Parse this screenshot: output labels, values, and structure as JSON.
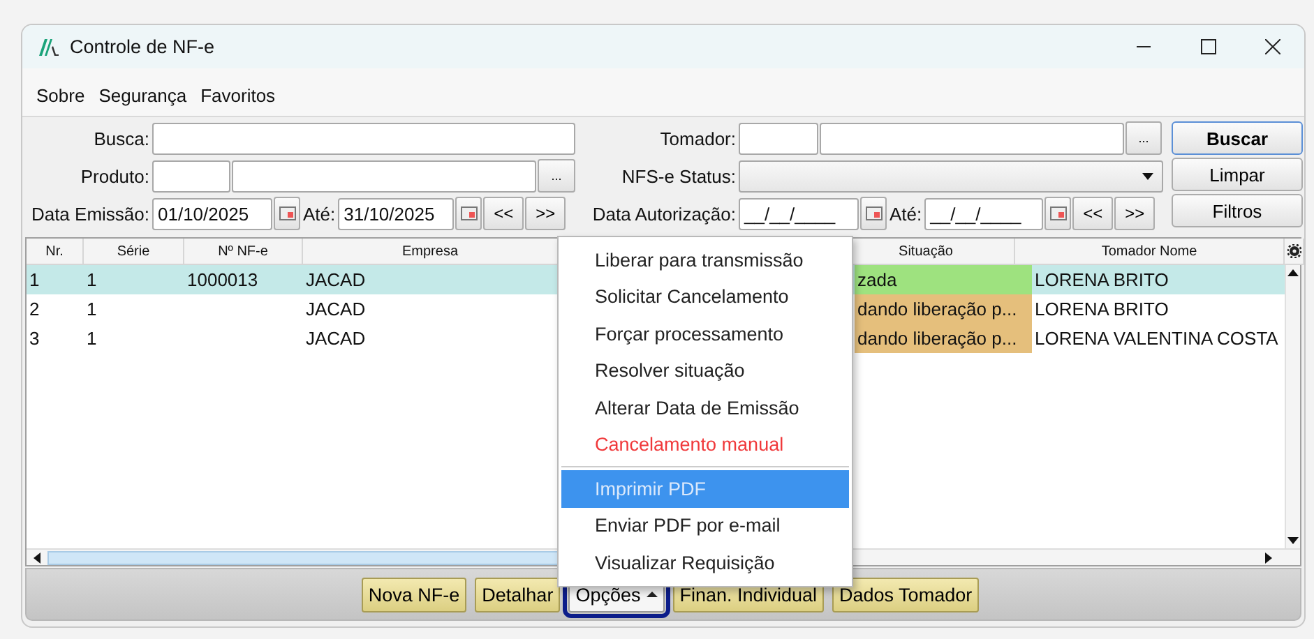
{
  "window": {
    "title": "Controle de NF-e"
  },
  "menu_bar": [
    {
      "label": "Sobre"
    },
    {
      "label": "Segurança"
    },
    {
      "label": "Favoritos"
    }
  ],
  "filters": {
    "search_label": "Busca:",
    "product_label": "Produto:",
    "product_lookup": "...",
    "issue_date_label": "Data Emissão:",
    "issue_from": "01/10/2025",
    "issue_to_label": "Até:",
    "issue_to": "31/10/2025",
    "issue_prev": "<<",
    "issue_next": ">>",
    "customer_label": "Tomador:",
    "customer_lookup": "...",
    "status_label": "NFS-e Status:",
    "auth_date_label": "Data Autorização:",
    "auth_from": "__/__/____",
    "auth_to_label": "Até:",
    "auth_to": "__/__/____",
    "auth_prev": "<<",
    "auth_next": ">>"
  },
  "side_buttons": [
    {
      "label": "Buscar",
      "default": true
    },
    {
      "label": "Limpar",
      "default": false
    },
    {
      "label": "Filtros",
      "default": false
    }
  ],
  "table": {
    "columns": [
      "Nr.",
      "Série",
      "Nº NF-e",
      "Empresa",
      "Situação",
      "Tomador Nome"
    ],
    "rows": [
      {
        "nr": "1",
        "serie": "1",
        "nf": "1000013",
        "empresa": "JACAD",
        "situacao": "zada",
        "color": "#9ee27f",
        "tomador": "LORENA BRITO",
        "selected": true
      },
      {
        "nr": "2",
        "serie": "1",
        "empresa": "JACAD",
        "situacao": "dando liberação p...",
        "color": "#e5bf7c",
        "tomador": "LORENA BRITO",
        "selected": false
      },
      {
        "nr": "3",
        "serie": "1",
        "empresa": "JACAD",
        "situacao": "dando liberação p...",
        "color": "#e5bf7c",
        "tomador": "LORENA VALENTINA COSTA",
        "selected": false
      }
    ]
  },
  "context_menu": [
    {
      "label": "Liberar para transmissão",
      "kind": "normal",
      "selected": false,
      "separator_before": false
    },
    {
      "label": "Solicitar Cancelamento",
      "kind": "normal",
      "selected": false,
      "separator_before": false
    },
    {
      "label": "Forçar processamento",
      "kind": "normal",
      "selected": false,
      "separator_before": false
    },
    {
      "label": "Resolver situação",
      "kind": "normal",
      "selected": false,
      "separator_before": false
    },
    {
      "label": "Alterar Data de Emissão",
      "kind": "normal",
      "selected": false,
      "separator_before": false
    },
    {
      "label": "Cancelamento manual",
      "kind": "danger",
      "selected": false,
      "separator_before": false
    },
    {
      "label": "Imprimir PDF",
      "kind": "normal",
      "selected": true,
      "separator_before": true
    },
    {
      "label": "Enviar PDF por e-mail",
      "kind": "normal",
      "selected": false,
      "separator_before": false
    },
    {
      "label": "Visualizar Requisição",
      "kind": "normal",
      "selected": false,
      "separator_before": false
    }
  ],
  "bottom_buttons": [
    {
      "label": "Nova NF-e",
      "kind": "plain",
      "focused": false
    },
    {
      "label": "Detalhar",
      "kind": "plain",
      "focused": false
    },
    {
      "label": "Opções",
      "kind": "dropdown",
      "focused": true
    },
    {
      "label": "Finan. Individual",
      "kind": "plain",
      "focused": false
    },
    {
      "label": "Dados Tomador",
      "kind": "plain",
      "focused": false
    }
  ]
}
